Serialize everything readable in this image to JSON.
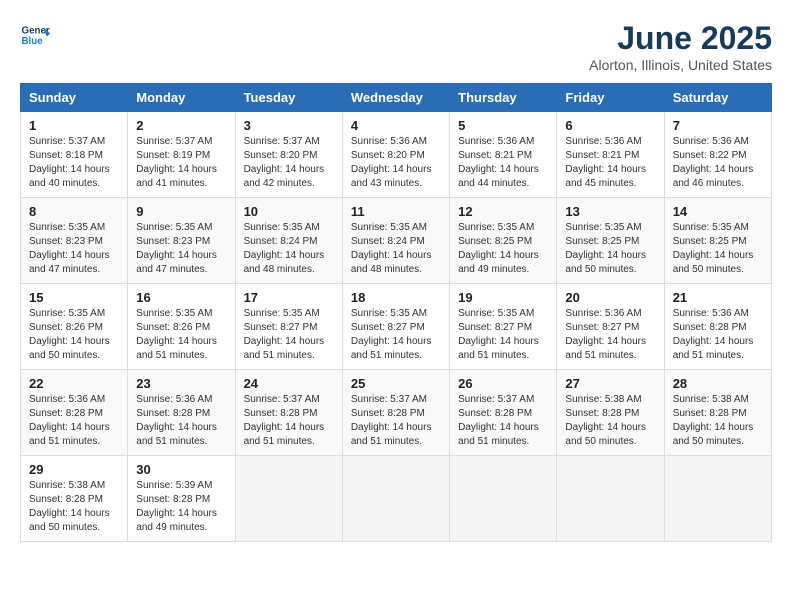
{
  "logo": {
    "line1": "General",
    "line2": "Blue"
  },
  "title": "June 2025",
  "subtitle": "Alorton, Illinois, United States",
  "days_header": [
    "Sunday",
    "Monday",
    "Tuesday",
    "Wednesday",
    "Thursday",
    "Friday",
    "Saturday"
  ],
  "weeks": [
    [
      {
        "day": "1",
        "sunrise": "5:37 AM",
        "sunset": "8:18 PM",
        "daylight": "14 hours and 40 minutes."
      },
      {
        "day": "2",
        "sunrise": "5:37 AM",
        "sunset": "8:19 PM",
        "daylight": "14 hours and 41 minutes."
      },
      {
        "day": "3",
        "sunrise": "5:37 AM",
        "sunset": "8:20 PM",
        "daylight": "14 hours and 42 minutes."
      },
      {
        "day": "4",
        "sunrise": "5:36 AM",
        "sunset": "8:20 PM",
        "daylight": "14 hours and 43 minutes."
      },
      {
        "day": "5",
        "sunrise": "5:36 AM",
        "sunset": "8:21 PM",
        "daylight": "14 hours and 44 minutes."
      },
      {
        "day": "6",
        "sunrise": "5:36 AM",
        "sunset": "8:21 PM",
        "daylight": "14 hours and 45 minutes."
      },
      {
        "day": "7",
        "sunrise": "5:36 AM",
        "sunset": "8:22 PM",
        "daylight": "14 hours and 46 minutes."
      }
    ],
    [
      {
        "day": "8",
        "sunrise": "5:35 AM",
        "sunset": "8:23 PM",
        "daylight": "14 hours and 47 minutes."
      },
      {
        "day": "9",
        "sunrise": "5:35 AM",
        "sunset": "8:23 PM",
        "daylight": "14 hours and 47 minutes."
      },
      {
        "day": "10",
        "sunrise": "5:35 AM",
        "sunset": "8:24 PM",
        "daylight": "14 hours and 48 minutes."
      },
      {
        "day": "11",
        "sunrise": "5:35 AM",
        "sunset": "8:24 PM",
        "daylight": "14 hours and 48 minutes."
      },
      {
        "day": "12",
        "sunrise": "5:35 AM",
        "sunset": "8:25 PM",
        "daylight": "14 hours and 49 minutes."
      },
      {
        "day": "13",
        "sunrise": "5:35 AM",
        "sunset": "8:25 PM",
        "daylight": "14 hours and 50 minutes."
      },
      {
        "day": "14",
        "sunrise": "5:35 AM",
        "sunset": "8:25 PM",
        "daylight": "14 hours and 50 minutes."
      }
    ],
    [
      {
        "day": "15",
        "sunrise": "5:35 AM",
        "sunset": "8:26 PM",
        "daylight": "14 hours and 50 minutes."
      },
      {
        "day": "16",
        "sunrise": "5:35 AM",
        "sunset": "8:26 PM",
        "daylight": "14 hours and 51 minutes."
      },
      {
        "day": "17",
        "sunrise": "5:35 AM",
        "sunset": "8:27 PM",
        "daylight": "14 hours and 51 minutes."
      },
      {
        "day": "18",
        "sunrise": "5:35 AM",
        "sunset": "8:27 PM",
        "daylight": "14 hours and 51 minutes."
      },
      {
        "day": "19",
        "sunrise": "5:35 AM",
        "sunset": "8:27 PM",
        "daylight": "14 hours and 51 minutes."
      },
      {
        "day": "20",
        "sunrise": "5:36 AM",
        "sunset": "8:27 PM",
        "daylight": "14 hours and 51 minutes."
      },
      {
        "day": "21",
        "sunrise": "5:36 AM",
        "sunset": "8:28 PM",
        "daylight": "14 hours and 51 minutes."
      }
    ],
    [
      {
        "day": "22",
        "sunrise": "5:36 AM",
        "sunset": "8:28 PM",
        "daylight": "14 hours and 51 minutes."
      },
      {
        "day": "23",
        "sunrise": "5:36 AM",
        "sunset": "8:28 PM",
        "daylight": "14 hours and 51 minutes."
      },
      {
        "day": "24",
        "sunrise": "5:37 AM",
        "sunset": "8:28 PM",
        "daylight": "14 hours and 51 minutes."
      },
      {
        "day": "25",
        "sunrise": "5:37 AM",
        "sunset": "8:28 PM",
        "daylight": "14 hours and 51 minutes."
      },
      {
        "day": "26",
        "sunrise": "5:37 AM",
        "sunset": "8:28 PM",
        "daylight": "14 hours and 51 minutes."
      },
      {
        "day": "27",
        "sunrise": "5:38 AM",
        "sunset": "8:28 PM",
        "daylight": "14 hours and 50 minutes."
      },
      {
        "day": "28",
        "sunrise": "5:38 AM",
        "sunset": "8:28 PM",
        "daylight": "14 hours and 50 minutes."
      }
    ],
    [
      {
        "day": "29",
        "sunrise": "5:38 AM",
        "sunset": "8:28 PM",
        "daylight": "14 hours and 50 minutes."
      },
      {
        "day": "30",
        "sunrise": "5:39 AM",
        "sunset": "8:28 PM",
        "daylight": "14 hours and 49 minutes."
      },
      null,
      null,
      null,
      null,
      null
    ]
  ]
}
